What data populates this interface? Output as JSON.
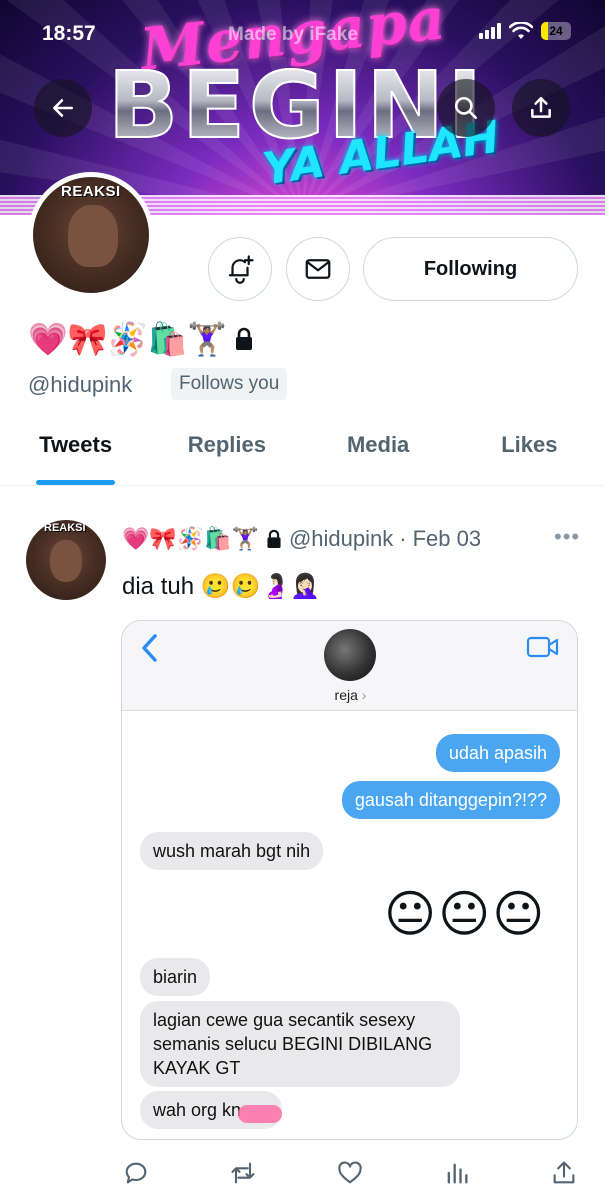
{
  "status_bar": {
    "time": "18:57",
    "battery_level": "24",
    "battery_fraction": 0.24
  },
  "header": {
    "banner_text_top": "Mengapa",
    "banner_text_main": "BEGINI",
    "banner_text_bottom": "YA ALLAH",
    "watermark": "Made by iFake",
    "back_icon": "arrow-left-icon",
    "search_icon": "search-icon",
    "share_icon": "share-icon"
  },
  "profile": {
    "avatar_tag": "REAKSI",
    "display_name_emojis": "💗🎀🪅🛍️🏋🏽‍♀️",
    "protected_icon": "lock-icon",
    "handle": "@hidupink",
    "follows_you_badge": "Follows you",
    "following_label": "Following",
    "notification_icon": "bell-plus-icon",
    "message_icon": "envelope-icon"
  },
  "tabs": [
    {
      "label": "Tweets",
      "active": true
    },
    {
      "label": "Replies",
      "active": false
    },
    {
      "label": "Media",
      "active": false
    },
    {
      "label": "Likes",
      "active": false
    }
  ],
  "tweet": {
    "author_emojis": "💗🎀🪅🛍️🏋🏽‍♀️",
    "handle": "@hidupink",
    "separator": "·",
    "date": "Feb 03",
    "more": "•••",
    "text": "dia tuh 🥲🥲🤰🏻🤦🏻‍♀️",
    "avatar_tag": "REAKSI"
  },
  "embedded_chat": {
    "contact_name": "reja",
    "messages": [
      {
        "from": "me",
        "text": "udah apasih"
      },
      {
        "from": "me",
        "text": "gausah ditanggepin?!??"
      },
      {
        "from": "them",
        "text": "wush marah bgt nih"
      },
      {
        "from": "me",
        "text": "😐😐😐"
      },
      {
        "from": "them",
        "text": "biarin"
      },
      {
        "from": "them",
        "text": "lagian cewe gua secantik sesexy semanis selucu BEGINI DIBILANG KAYAK GT"
      },
      {
        "from": "them",
        "text": "wah org kn"
      }
    ]
  },
  "actions": [
    "reply-icon",
    "retweet-icon",
    "like-icon",
    "analytics-icon",
    "share-icon"
  ],
  "colors": {
    "accent": "#1d9bf0",
    "text_primary": "#0f1419",
    "text_secondary": "#536471",
    "imessage_blue": "#4aa6f1",
    "imessage_gray": "#e9e9eb"
  }
}
